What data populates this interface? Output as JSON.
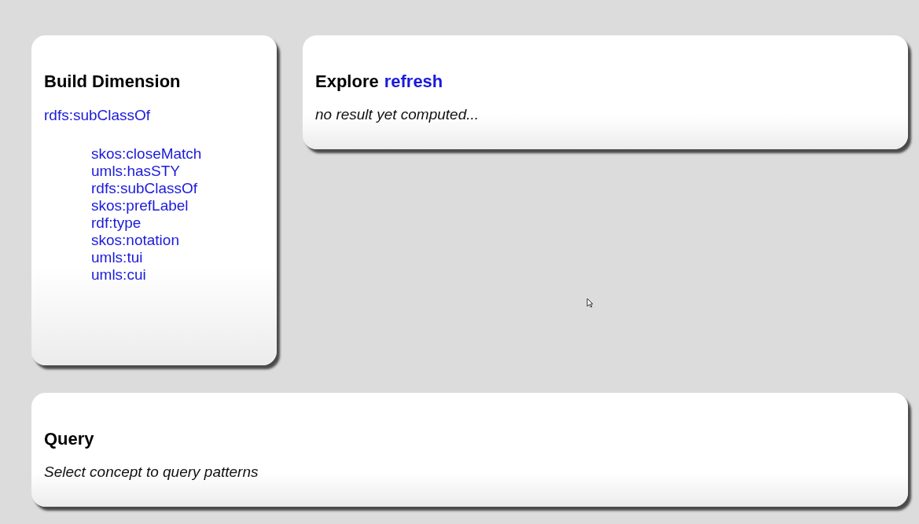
{
  "build_dimension": {
    "title": "Build Dimension",
    "tree": [
      {
        "label": "rdfs:subClassOf",
        "children": [
          {
            "label": "skos:closeMatch"
          },
          {
            "label": "umls:hasSTY"
          },
          {
            "label": "rdfs:subClassOf"
          },
          {
            "label": "skos:prefLabel"
          },
          {
            "label": "rdf:type"
          },
          {
            "label": "skos:notation"
          },
          {
            "label": "umls:tui"
          },
          {
            "label": "umls:cui"
          }
        ]
      }
    ]
  },
  "explore": {
    "title": "Explore",
    "link": "refresh",
    "message": "no result yet computed..."
  },
  "query": {
    "title": "Query",
    "message": "Select concept to query patterns"
  }
}
